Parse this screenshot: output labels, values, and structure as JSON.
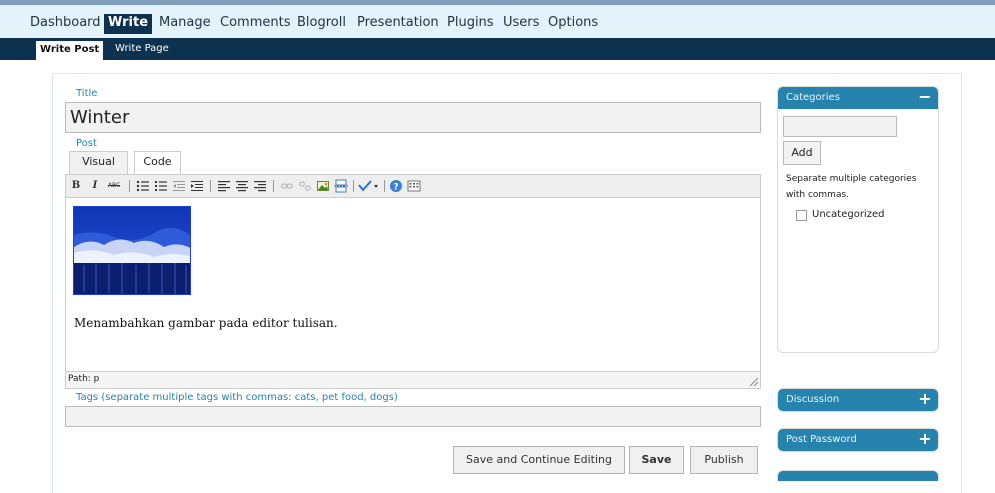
{
  "nav": {
    "items": [
      "Dashboard",
      "Write",
      "Manage",
      "Comments",
      "Blogroll",
      "Presentation",
      "Plugins",
      "Users",
      "Options"
    ],
    "active": "Write"
  },
  "subnav": {
    "items": [
      "Write Post",
      "Write Page"
    ],
    "active": "Write Post"
  },
  "form": {
    "title_label": "Title",
    "title_value": "Winter",
    "post_label": "Post",
    "tabs": [
      "Visual",
      "Code"
    ],
    "active_tab": "Visual",
    "editor_text": "Menambahkan gambar pada editor tulisan.",
    "status_path": "Path: p",
    "tags_label": "Tags (separate multiple tags with commas: cats, pet food, dogs)",
    "tags_value": "",
    "buttons": {
      "save_continue": "Save and Continue Editing",
      "save": "Save",
      "publish": "Publish"
    }
  },
  "toolbar": {
    "icons": [
      "bold-icon",
      "italic-icon",
      "strikethrough-icon",
      "bullet-list-icon",
      "numbered-list-icon",
      "outdent-icon",
      "indent-icon",
      "align-left-icon",
      "align-center-icon",
      "align-right-icon",
      "link-icon",
      "unlink-icon",
      "image-icon",
      "page-break-icon",
      "spellcheck-icon",
      "help-icon",
      "kitchen-sink-icon"
    ],
    "bold_glyph": "B",
    "italic_glyph": "I",
    "strike_glyph": "ABC"
  },
  "sidebar": {
    "categories": {
      "title": "Categories",
      "toggle": "−",
      "add_label": "Add",
      "help": "Separate multiple categories with commas.",
      "items": [
        {
          "label": "Uncategorized",
          "checked": false
        }
      ]
    },
    "discussion": {
      "title": "Discussion",
      "toggle": "+"
    },
    "post_password": {
      "title": "Post Password",
      "toggle": "+"
    }
  },
  "colors": {
    "nav_bg": "#e4f2fc",
    "nav_active": "#0d324f",
    "accent": "#2683ae",
    "label": "#2583ad"
  }
}
